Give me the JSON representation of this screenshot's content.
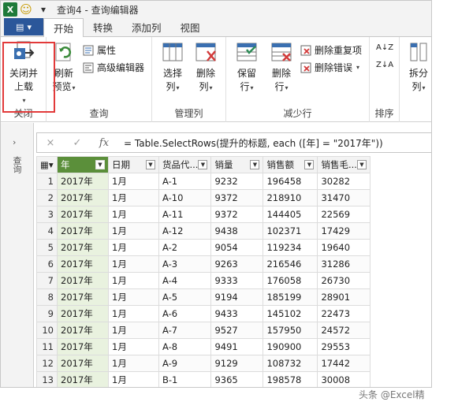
{
  "window": {
    "title": "查询4 - 查询编辑器"
  },
  "quick_access": {
    "app_icon": "X",
    "smile_icon": "smiley-icon",
    "dropdown": "▾"
  },
  "tabs": [
    {
      "label": "开始",
      "active": true
    },
    {
      "label": "转换",
      "active": false
    },
    {
      "label": "添加列",
      "active": false
    },
    {
      "label": "视图",
      "active": false
    }
  ],
  "ribbon": {
    "close": {
      "btn1": "关闭并",
      "btn1b": "上载",
      "caret": "▾",
      "group": "关闭"
    },
    "query": {
      "refresh1": "刷新",
      "refresh2": "预览",
      "properties": "属性",
      "advanced": "高级编辑器",
      "group": "查询"
    },
    "manage": {
      "choose1": "选择",
      "choose2": "列",
      "delete1": "删除",
      "delete2": "列",
      "group": "管理列"
    },
    "reduce": {
      "keep1": "保留",
      "keep2": "行",
      "delete1": "删除",
      "delete2": "行",
      "remove_dup": "删除重复项",
      "remove_err": "删除错误",
      "group": "减少行"
    },
    "sort": {
      "group": "排序",
      "asc": "A↓Z",
      "desc": "Z↓A"
    },
    "split": {
      "label1": "拆分",
      "label2": "列"
    }
  },
  "query_pane": {
    "label": "查询"
  },
  "formula_bar": {
    "cancel": "×",
    "confirm": "✓",
    "fx": "fx",
    "formula": "= Table.SelectRows(提升的标题, each ([年] = \"2017年\"))"
  },
  "table": {
    "columns": [
      "年",
      "日期",
      "货品代...",
      "销量",
      "销售额",
      "销售毛..."
    ],
    "rows": [
      [
        "1",
        "2017年",
        "1月",
        "A-1",
        "9232",
        "196458",
        "30282"
      ],
      [
        "2",
        "2017年",
        "1月",
        "A-10",
        "9372",
        "218910",
        "31470"
      ],
      [
        "3",
        "2017年",
        "1月",
        "A-11",
        "9372",
        "144405",
        "22569"
      ],
      [
        "4",
        "2017年",
        "1月",
        "A-12",
        "9438",
        "102371",
        "17429"
      ],
      [
        "5",
        "2017年",
        "1月",
        "A-2",
        "9054",
        "119234",
        "19640"
      ],
      [
        "6",
        "2017年",
        "1月",
        "A-3",
        "9263",
        "216546",
        "31286"
      ],
      [
        "7",
        "2017年",
        "1月",
        "A-4",
        "9333",
        "176058",
        "26730"
      ],
      [
        "8",
        "2017年",
        "1月",
        "A-5",
        "9194",
        "185199",
        "28901"
      ],
      [
        "9",
        "2017年",
        "1月",
        "A-6",
        "9433",
        "145102",
        "22473"
      ],
      [
        "10",
        "2017年",
        "1月",
        "A-7",
        "9527",
        "157950",
        "24572"
      ],
      [
        "11",
        "2017年",
        "1月",
        "A-8",
        "9491",
        "190900",
        "29553"
      ],
      [
        "12",
        "2017年",
        "1月",
        "A-9",
        "9129",
        "108732",
        "17442"
      ],
      [
        "13",
        "2017年",
        "1月",
        "B-1",
        "9365",
        "198578",
        "30008"
      ]
    ]
  },
  "watermark": "头条 @Excel精",
  "colors": {
    "accent_green": "#5b8f3a",
    "file_blue": "#2b579a",
    "highlight_red": "#e23a3a"
  }
}
